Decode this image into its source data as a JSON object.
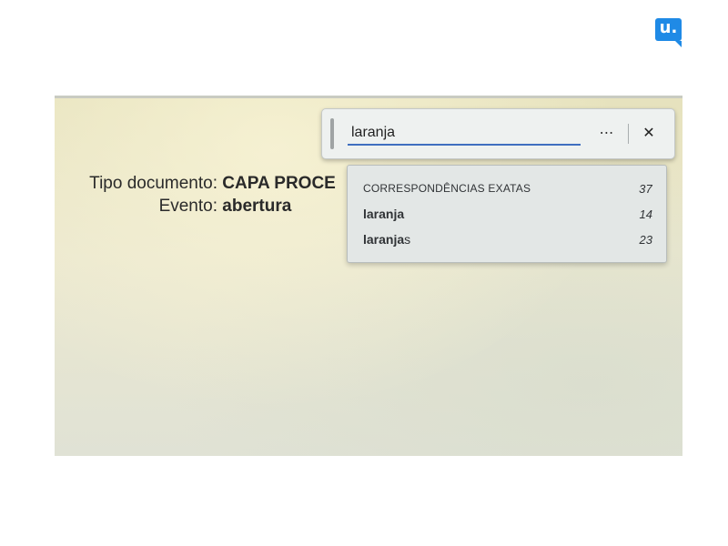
{
  "brand": {
    "logo_text": "u."
  },
  "document": {
    "tipo_label": "Tipo documento:",
    "tipo_value": "CAPA PROCE",
    "evento_label": "Evento:",
    "evento_value": "abertura"
  },
  "find_bar": {
    "query": "laranja",
    "more_icon": "more-horizontal-icon",
    "close_icon": "close-icon"
  },
  "suggestions": {
    "header_label": "CORRESPONDÊNCIAS EXATAS",
    "header_count": "37",
    "items": [
      {
        "match": "laranja",
        "suffix": "",
        "count": "14"
      },
      {
        "match": "laranja",
        "suffix": "s",
        "count": "23"
      }
    ]
  },
  "colors": {
    "accent": "#3f6fc0",
    "brand": "#1f8ae6"
  }
}
